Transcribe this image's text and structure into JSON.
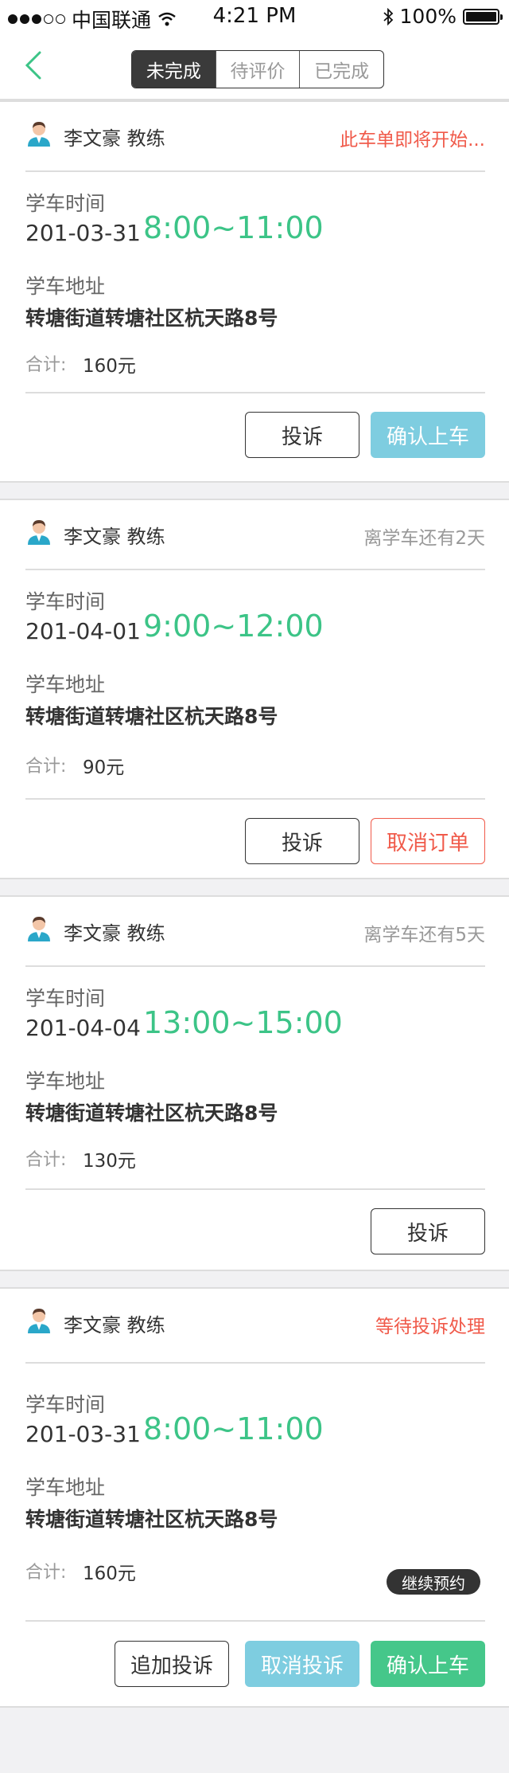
{
  "status_bar": {
    "carrier": "中国联通",
    "time": "4:21 PM",
    "battery": "100%"
  },
  "tabs": [
    "未完成",
    "待评价",
    "已完成"
  ],
  "orders": [
    {
      "coach": "李文豪 教练",
      "status": "此车单即将开始...",
      "time_label": "学车时间",
      "date": "201-03-31",
      "time": "8:00~11:00",
      "address_label": "学车地址",
      "address": "转塘街道转塘社区杭天路8号",
      "total_label": "合计:",
      "total": "160元",
      "buttons": [
        "投诉",
        "确认上车"
      ]
    },
    {
      "coach": "李文豪 教练",
      "status": "离学车还有2天",
      "time_label": "学车时间",
      "date": "201-04-01",
      "time": "9:00~12:00",
      "address_label": "学车地址",
      "address": "转塘街道转塘社区杭天路8号",
      "total_label": "合计:",
      "total": "90元",
      "buttons": [
        "投诉",
        "取消订单"
      ]
    },
    {
      "coach": "李文豪 教练",
      "status": "离学车还有5天",
      "time_label": "学车时间",
      "date": "201-04-04",
      "time": "13:00~15:00",
      "address_label": "学车地址",
      "address": "转塘街道转塘社区杭天路8号",
      "total_label": "合计:",
      "total": "130元",
      "buttons": [
        "投诉"
      ]
    },
    {
      "coach": "李文豪 教练",
      "status": "等待投诉处理",
      "time_label": "学车时间",
      "date": "201-03-31",
      "time": "8:00~11:00",
      "address_label": "学车地址",
      "address": "转塘街道转塘社区杭天路8号",
      "total_label": "合计:",
      "total": "160元",
      "badge": "继续预约",
      "buttons": [
        "追加投诉",
        "取消投诉",
        "确认上车"
      ]
    }
  ],
  "colors": {
    "accent_green": "#3cc487",
    "status_red": "#f05a4a",
    "button_blue": "#7ecde0",
    "button_green": "#45c78a"
  }
}
